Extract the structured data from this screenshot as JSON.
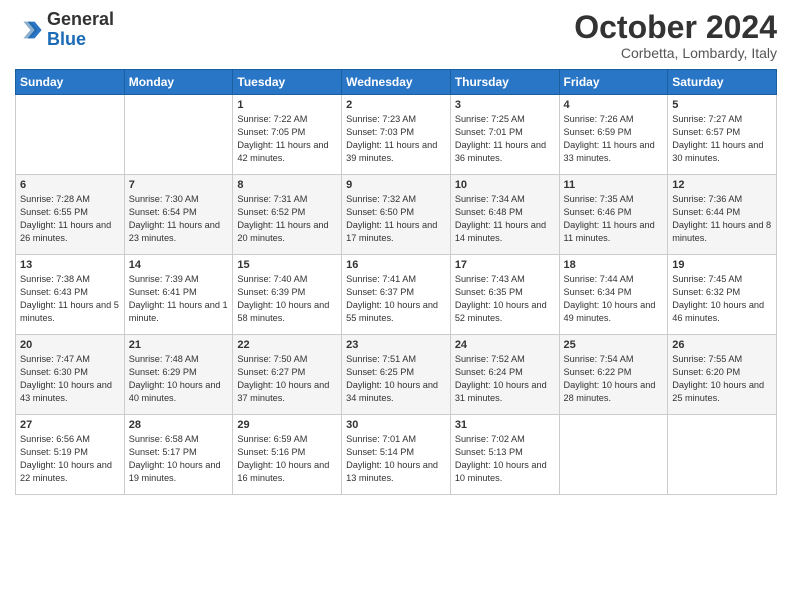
{
  "logo": {
    "text_general": "General",
    "text_blue": "Blue"
  },
  "header": {
    "month": "October 2024",
    "location": "Corbetta, Lombardy, Italy"
  },
  "days_of_week": [
    "Sunday",
    "Monday",
    "Tuesday",
    "Wednesday",
    "Thursday",
    "Friday",
    "Saturday"
  ],
  "weeks": [
    [
      {
        "day": "",
        "info": ""
      },
      {
        "day": "",
        "info": ""
      },
      {
        "day": "1",
        "info": "Sunrise: 7:22 AM\nSunset: 7:05 PM\nDaylight: 11 hours and 42 minutes."
      },
      {
        "day": "2",
        "info": "Sunrise: 7:23 AM\nSunset: 7:03 PM\nDaylight: 11 hours and 39 minutes."
      },
      {
        "day": "3",
        "info": "Sunrise: 7:25 AM\nSunset: 7:01 PM\nDaylight: 11 hours and 36 minutes."
      },
      {
        "day": "4",
        "info": "Sunrise: 7:26 AM\nSunset: 6:59 PM\nDaylight: 11 hours and 33 minutes."
      },
      {
        "day": "5",
        "info": "Sunrise: 7:27 AM\nSunset: 6:57 PM\nDaylight: 11 hours and 30 minutes."
      }
    ],
    [
      {
        "day": "6",
        "info": "Sunrise: 7:28 AM\nSunset: 6:55 PM\nDaylight: 11 hours and 26 minutes."
      },
      {
        "day": "7",
        "info": "Sunrise: 7:30 AM\nSunset: 6:54 PM\nDaylight: 11 hours and 23 minutes."
      },
      {
        "day": "8",
        "info": "Sunrise: 7:31 AM\nSunset: 6:52 PM\nDaylight: 11 hours and 20 minutes."
      },
      {
        "day": "9",
        "info": "Sunrise: 7:32 AM\nSunset: 6:50 PM\nDaylight: 11 hours and 17 minutes."
      },
      {
        "day": "10",
        "info": "Sunrise: 7:34 AM\nSunset: 6:48 PM\nDaylight: 11 hours and 14 minutes."
      },
      {
        "day": "11",
        "info": "Sunrise: 7:35 AM\nSunset: 6:46 PM\nDaylight: 11 hours and 11 minutes."
      },
      {
        "day": "12",
        "info": "Sunrise: 7:36 AM\nSunset: 6:44 PM\nDaylight: 11 hours and 8 minutes."
      }
    ],
    [
      {
        "day": "13",
        "info": "Sunrise: 7:38 AM\nSunset: 6:43 PM\nDaylight: 11 hours and 5 minutes."
      },
      {
        "day": "14",
        "info": "Sunrise: 7:39 AM\nSunset: 6:41 PM\nDaylight: 11 hours and 1 minute."
      },
      {
        "day": "15",
        "info": "Sunrise: 7:40 AM\nSunset: 6:39 PM\nDaylight: 10 hours and 58 minutes."
      },
      {
        "day": "16",
        "info": "Sunrise: 7:41 AM\nSunset: 6:37 PM\nDaylight: 10 hours and 55 minutes."
      },
      {
        "day": "17",
        "info": "Sunrise: 7:43 AM\nSunset: 6:35 PM\nDaylight: 10 hours and 52 minutes."
      },
      {
        "day": "18",
        "info": "Sunrise: 7:44 AM\nSunset: 6:34 PM\nDaylight: 10 hours and 49 minutes."
      },
      {
        "day": "19",
        "info": "Sunrise: 7:45 AM\nSunset: 6:32 PM\nDaylight: 10 hours and 46 minutes."
      }
    ],
    [
      {
        "day": "20",
        "info": "Sunrise: 7:47 AM\nSunset: 6:30 PM\nDaylight: 10 hours and 43 minutes."
      },
      {
        "day": "21",
        "info": "Sunrise: 7:48 AM\nSunset: 6:29 PM\nDaylight: 10 hours and 40 minutes."
      },
      {
        "day": "22",
        "info": "Sunrise: 7:50 AM\nSunset: 6:27 PM\nDaylight: 10 hours and 37 minutes."
      },
      {
        "day": "23",
        "info": "Sunrise: 7:51 AM\nSunset: 6:25 PM\nDaylight: 10 hours and 34 minutes."
      },
      {
        "day": "24",
        "info": "Sunrise: 7:52 AM\nSunset: 6:24 PM\nDaylight: 10 hours and 31 minutes."
      },
      {
        "day": "25",
        "info": "Sunrise: 7:54 AM\nSunset: 6:22 PM\nDaylight: 10 hours and 28 minutes."
      },
      {
        "day": "26",
        "info": "Sunrise: 7:55 AM\nSunset: 6:20 PM\nDaylight: 10 hours and 25 minutes."
      }
    ],
    [
      {
        "day": "27",
        "info": "Sunrise: 6:56 AM\nSunset: 5:19 PM\nDaylight: 10 hours and 22 minutes."
      },
      {
        "day": "28",
        "info": "Sunrise: 6:58 AM\nSunset: 5:17 PM\nDaylight: 10 hours and 19 minutes."
      },
      {
        "day": "29",
        "info": "Sunrise: 6:59 AM\nSunset: 5:16 PM\nDaylight: 10 hours and 16 minutes."
      },
      {
        "day": "30",
        "info": "Sunrise: 7:01 AM\nSunset: 5:14 PM\nDaylight: 10 hours and 13 minutes."
      },
      {
        "day": "31",
        "info": "Sunrise: 7:02 AM\nSunset: 5:13 PM\nDaylight: 10 hours and 10 minutes."
      },
      {
        "day": "",
        "info": ""
      },
      {
        "day": "",
        "info": ""
      }
    ]
  ]
}
